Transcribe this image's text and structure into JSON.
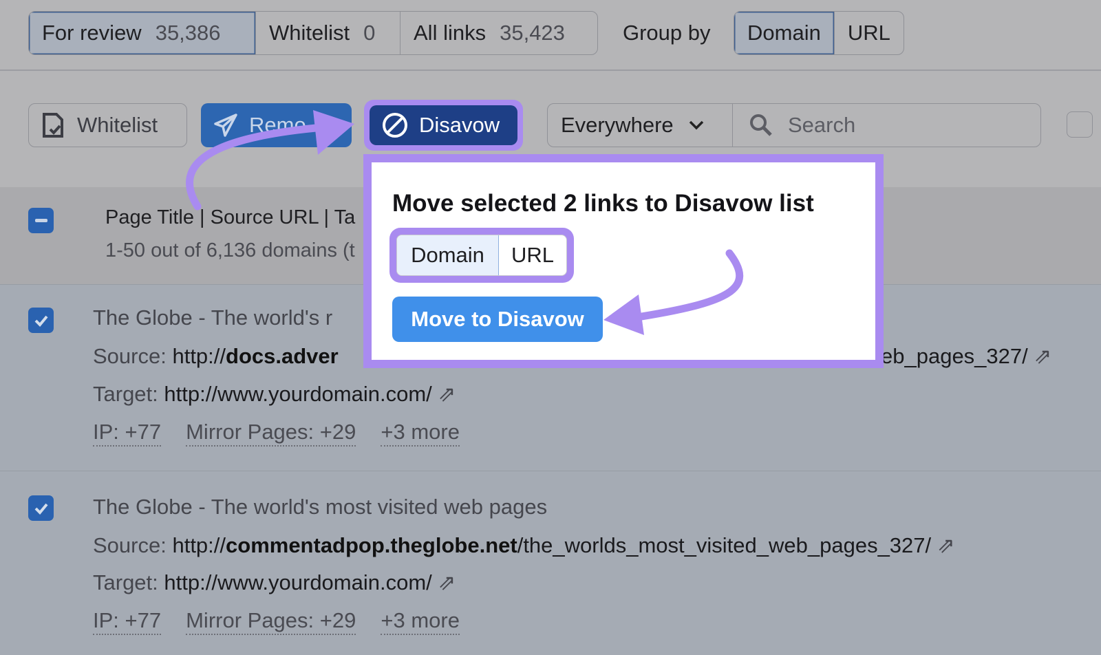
{
  "tabs": [
    {
      "label": "For review",
      "count": "35,386"
    },
    {
      "label": "Whitelist",
      "count": "0"
    },
    {
      "label": "All links",
      "count": "35,423"
    }
  ],
  "group_by": {
    "label": "Group by",
    "options": [
      "Domain",
      "URL"
    ],
    "selected": "Domain"
  },
  "toolbar": {
    "whitelist": "Whitelist",
    "remove": "Remo",
    "disavow": "Disavow",
    "scope": "Everywhere",
    "search_placeholder": "Search"
  },
  "header": {
    "columns": "Page Title | Source URL | Ta",
    "summary": "1-50 out of 6,136 domains (t"
  },
  "popover": {
    "title": "Move selected 2 links to Disavow list",
    "options": [
      "Domain",
      "URL"
    ],
    "selected": "Domain",
    "action": "Move to Disavow"
  },
  "rows": [
    {
      "title": "The Globe - The world's r",
      "source_label": "Source:",
      "source_prefix": "http://",
      "source_domain": "docs.adver",
      "source_rest": "eb_pages_327/",
      "target_label": "Target:",
      "target": "http://www.yourdomain.com/",
      "ip": "IP: +77",
      "mirror": "Mirror Pages: +29",
      "more": "+3 more",
      "checked": true
    },
    {
      "title": "The Globe - The world's most visited web pages",
      "source_label": "Source:",
      "source_prefix": "http://",
      "source_domain": "commentadpop.theglobe.net",
      "source_rest": "/the_worlds_most_visited_web_pages_327/",
      "target_label": "Target:",
      "target": "http://www.yourdomain.com/",
      "ip": "IP: +77",
      "mirror": "Mirror Pages: +29",
      "more": "+3 more",
      "checked": true
    }
  ],
  "colors": {
    "highlight": "#a98bf0",
    "primary": "#4090ea",
    "disavow": "#1e3f86"
  }
}
